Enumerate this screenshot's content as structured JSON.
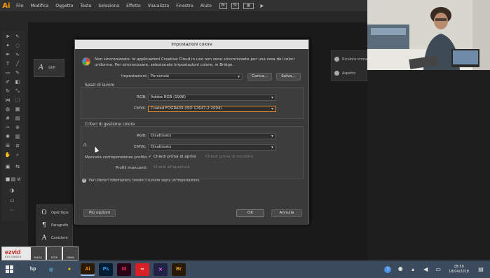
{
  "app": {
    "logo": "Ai",
    "menu": [
      "File",
      "Modifica",
      "Oggetto",
      "Testo",
      "Seleziona",
      "Effetto",
      "Visualizza",
      "Finestra",
      "Aiuto"
    ],
    "menubar_icons": [
      "Br",
      "St",
      "arrange-icon",
      "send-icon"
    ]
  },
  "glyph_panel": {
    "glyph": "A",
    "label": "Glifi"
  },
  "right_panel": {
    "items": [
      {
        "icon": "recolor-icon",
        "label": "Ricolora immagine"
      },
      {
        "icon": "appearance-icon",
        "label": "Aspetto"
      }
    ]
  },
  "type_panel": {
    "items": [
      {
        "glyph": "O",
        "label": "OpenType"
      },
      {
        "glyph": "¶",
        "label": "Paragrafo"
      },
      {
        "glyph": "A",
        "label": "Carattere"
      }
    ]
  },
  "recorder": {
    "brand": "ezvid",
    "sub": "RECORDER",
    "buttons": [
      "PAUSE",
      "STOP",
      "DRAW"
    ]
  },
  "dialog": {
    "title": "Impostazioni colore",
    "sync_message": "Non sincronizzato: le applicazioni Creative Cloud in uso non sono sincronizzate per una resa dei colori uniforme. Per sincronizzare, selezionate Impostazioni colore, in Bridge.",
    "settings_label": "Impostazioni:",
    "settings_value": "Personale",
    "load_button": "Carica...",
    "save_button": "Salva...",
    "workspaces": {
      "title": "Spazi di lavoro",
      "rgb_label": "RGB:",
      "rgb_value": "Adobe RGB (1998)",
      "cmyk_label": "CMYK:",
      "cmyk_value": "Coated FOGRA39 (ISO 12647-2:2004)"
    },
    "policies": {
      "title": "Criteri di gestione colore",
      "rgb_label": "RGB:",
      "rgb_value": "Disattivato",
      "cmyk_label": "CMYK:",
      "cmyk_value": "Disattivato",
      "mismatch_label": "Mancata corrispondenze profilo:",
      "ask_open": "Chiedi prima di aprire",
      "ask_open_checked": true,
      "ask_paste": "Chiedi prima di incollare",
      "missing_label": "Profili mancanti:",
      "ask_on_open": "Chiedi all'apertura"
    },
    "info": "Per ulteriori informazioni, tenete il cursore sopra un'impostazione.",
    "more_options": "Più opzioni",
    "ok": "OK",
    "cancel": "Annulla"
  },
  "taskbar": {
    "apps": [
      {
        "name": "hp-icon",
        "text": "hp",
        "bg": "#3b4a5c",
        "fg": "#e8e8e8"
      },
      {
        "name": "app-network-icon",
        "text": "◎",
        "bg": "#3b4a5c",
        "fg": "#5fb0e6"
      },
      {
        "name": "chrome-icon",
        "text": "●",
        "bg": "#3b4a5c",
        "fg": "#f2c200"
      },
      {
        "name": "illustrator-icon",
        "text": "Ai",
        "bg": "#2a1a05",
        "fg": "#ff9a00"
      },
      {
        "name": "photoshop-icon",
        "text": "Ps",
        "bg": "#001d34",
        "fg": "#31a8ff"
      },
      {
        "name": "indesign-icon",
        "text": "Id",
        "bg": "#2a0216",
        "fg": "#ff3366"
      },
      {
        "name": "creative-cloud-icon",
        "text": "∞",
        "bg": "#da1f26",
        "fg": "#ffffff"
      },
      {
        "name": "colorful-app-icon",
        "text": "✕",
        "bg": "#222244",
        "fg": "#e05aff"
      },
      {
        "name": "bridge-icon",
        "text": "Br",
        "bg": "#2a1a05",
        "fg": "#e8a83a"
      }
    ],
    "time": "18:50",
    "date": "18/04/2018"
  }
}
